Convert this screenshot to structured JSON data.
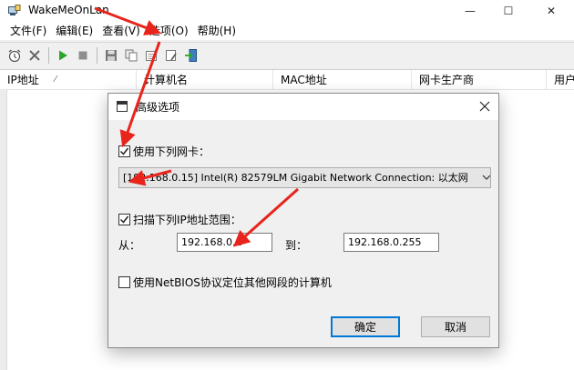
{
  "window": {
    "title": "WakeMeOnLan",
    "minimize_glyph": "—",
    "maximize_glyph": "☐",
    "close_glyph": "✕"
  },
  "menu": [
    {
      "label": "文件(F)"
    },
    {
      "label": "编辑(E)"
    },
    {
      "label": "查看(V)"
    },
    {
      "label": "选项(O)"
    },
    {
      "label": "帮助(H)"
    }
  ],
  "toolbar": {
    "icons": [
      "alarm-clock-icon",
      "delete-icon",
      "play-icon",
      "stop-icon",
      "save-icon",
      "copy-icon",
      "properties-icon",
      "options-icon",
      "exit-icon"
    ]
  },
  "list": {
    "columns": [
      "IP地址",
      "计算机名",
      "MAC地址",
      "网卡生产商",
      "用户"
    ],
    "sort_indicator": "⁄"
  },
  "dialog": {
    "title": "高级选项",
    "close_glyph": "✕",
    "use_adapter_label": "使用下列网卡：",
    "use_adapter_checked": true,
    "adapter_value": "[192.168.0.15]  Intel(R) 82579LM Gigabit Network Connection:  以太网",
    "scan_range_label": "扫描下列IP地址范围：",
    "scan_range_checked": true,
    "from_label": "从：",
    "from_value": "192.168.0.1",
    "to_label": "到：",
    "to_value": "192.168.0.255",
    "netbios_label": "使用NetBIOS协议定位其他网段的计算机",
    "netbios_checked": false,
    "ok_label": "确定",
    "cancel_label": "取消"
  },
  "colors": {
    "accent_blue": "#0078d7",
    "arrow_red": "#e8241c"
  }
}
